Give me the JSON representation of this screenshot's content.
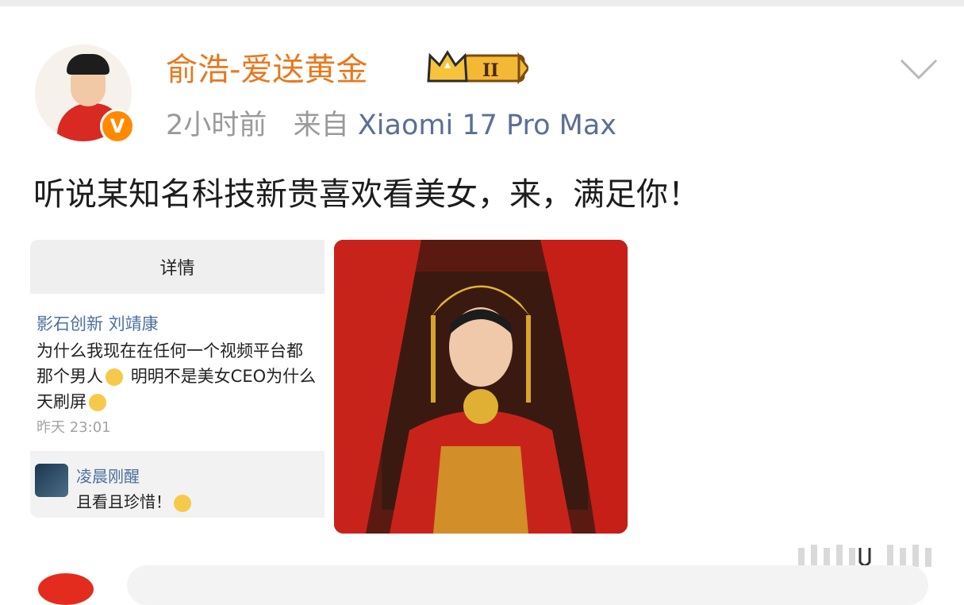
{
  "post": {
    "username": "俞浩-爱送黄金",
    "time": "2小时前",
    "source_prefix": "来自",
    "device": "Xiaomi 17 Pro Max",
    "text": "听说某知名科技新贵喜欢看美女，来，满足你！",
    "badge_level": "II",
    "verified_mark": "V"
  },
  "screenshot_card": {
    "header": "详情",
    "author": "影石创新 刘靖康",
    "lines": [
      "为什么我现在在任何一个视频平台都",
      "那个男人",
      "明明不是美女CEO为什么",
      "天刷屏"
    ],
    "time": "昨天 23:01",
    "reply": {
      "name": "凌晨刚醒",
      "text": "且看且珍惜！"
    }
  },
  "icons": [
    "verified-badge-icon",
    "crown-level-icon",
    "chevron-down-icon",
    "emoji-icon",
    "watermark-icon"
  ],
  "colors": {
    "username": "#e8781e",
    "device_link": "#5b6f94",
    "link_blue": "#4d6f9c",
    "verified": "#ff8a00",
    "photo_red": "#c8231b"
  }
}
